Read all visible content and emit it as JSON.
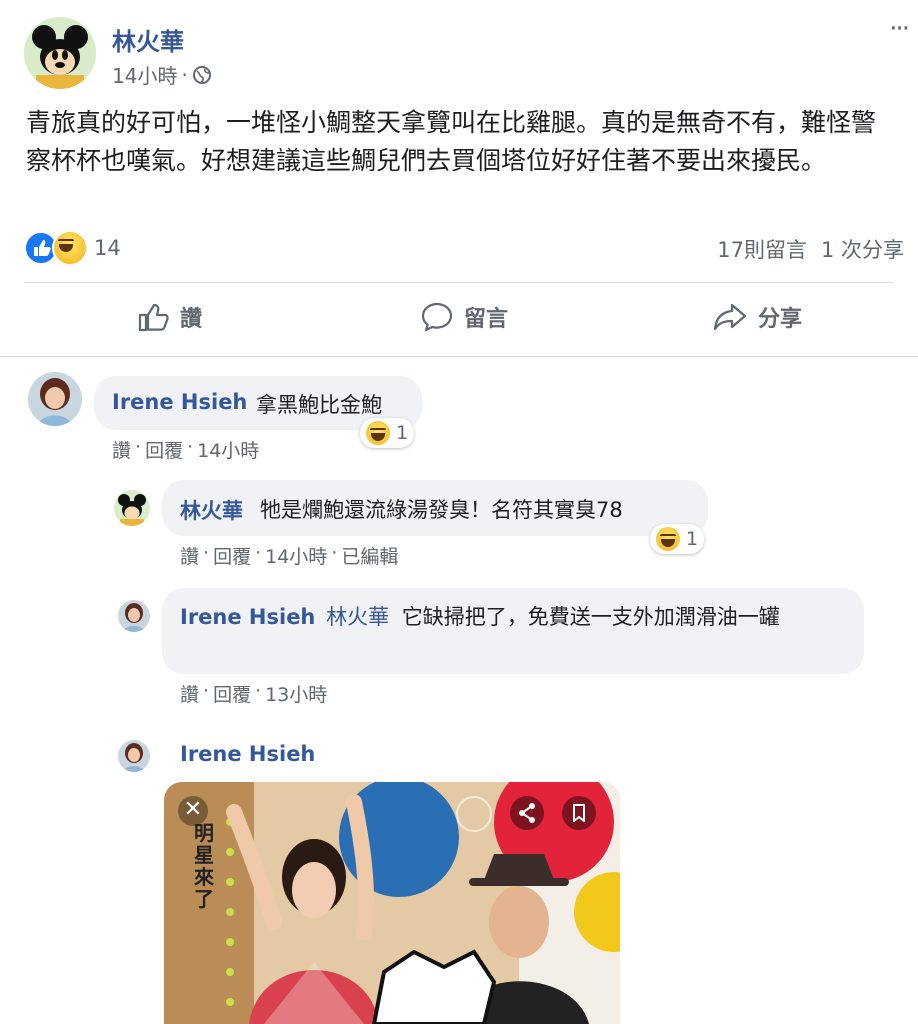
{
  "post": {
    "author": "林火華",
    "time": "14小時",
    "dot": "·",
    "body": "青旅真的好可怕，一堆怪小鯛整天拿覽叫在比雞腿。真的是無奇不有，難怪警察杯杯也嘆氣。好想建議這些鯛兒們去買個塔位好好住著不要出來擾民。",
    "reaction_count": "14",
    "comments_count": "17則留言",
    "shares_count": "1 次分享",
    "more_label": "···"
  },
  "actions": {
    "like": "讚",
    "comment": "留言",
    "share": "分享"
  },
  "comments": [
    {
      "author": "Irene Hsieh",
      "text": "拿黑鮑比金鮑",
      "reaction_count": "1",
      "like": "讚",
      "reply": "回覆",
      "time": "14小時"
    },
    {
      "author": "林火華",
      "text": "牠是爛鮑還流綠湯發臭！名符其實臭78",
      "reaction_count": "1",
      "like": "讚",
      "reply": "回覆",
      "time": "14小時",
      "edited": "已編輯"
    },
    {
      "author": "Irene Hsieh",
      "mention": "林火華",
      "text": "它缺掃把了，免費送一支外加潤滑油一罐",
      "like": "讚",
      "reply": "回覆",
      "time": "13小時"
    },
    {
      "author": "Irene Hsieh"
    }
  ],
  "image": {
    "caption_vertical": "明星來了"
  },
  "colors": {
    "link": "#365899",
    "meta": "#606770",
    "bubble": "#f0f2f5"
  }
}
